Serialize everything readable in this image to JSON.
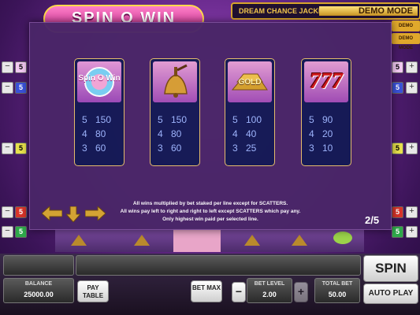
{
  "game": {
    "logo_text": "SPIN O WIN",
    "jackpot_label": "DREAM CHANCE JACKPOT",
    "demo_mode": "DEMO MODE",
    "demo_mode_small": "DEMO MODE"
  },
  "side_markers": {
    "left": [
      "5",
      "5",
      "5",
      "5",
      "5"
    ],
    "right": [
      "5",
      "5",
      "5",
      "5",
      "5"
    ],
    "left_colors": [
      "#f2c9f2",
      "#3a52d8",
      "#e7e04c",
      "#d8342a",
      "#2ea84a"
    ],
    "right_colors": [
      "#f2c9f2",
      "#3a52d8",
      "#e7e04c",
      "#d8342a",
      "#2ea84a"
    ]
  },
  "paytable": {
    "symbols": [
      {
        "icon": "spin-o-win-logo-icon",
        "logo_text": "Spin O Win",
        "pays": [
          {
            "count": "5",
            "value": "150"
          },
          {
            "count": "4",
            "value": "80"
          },
          {
            "count": "3",
            "value": "60"
          }
        ]
      },
      {
        "icon": "bell-icon",
        "pays": [
          {
            "count": "5",
            "value": "150"
          },
          {
            "count": "4",
            "value": "80"
          },
          {
            "count": "3",
            "value": "60"
          }
        ]
      },
      {
        "icon": "gold-bars-icon",
        "logo_text": "GOLD",
        "pays": [
          {
            "count": "5",
            "value": "100"
          },
          {
            "count": "4",
            "value": "40"
          },
          {
            "count": "3",
            "value": "25"
          }
        ]
      },
      {
        "icon": "triple-seven-icon",
        "logo_text": "777",
        "pays": [
          {
            "count": "5",
            "value": "90"
          },
          {
            "count": "4",
            "value": "20"
          },
          {
            "count": "3",
            "value": "10"
          }
        ]
      }
    ],
    "notes": [
      "All wins multiplied by bet staked per line except for SCATTERS.",
      "All wins pay left to right and right to left except SCATTERS which pay any.",
      "Only highest win paid per selected line."
    ],
    "page": "2/5"
  },
  "controls": {
    "balance_label": "BALANCE",
    "balance_value": "25000.00",
    "paytable_label": "PAY TABLE",
    "bet_max_label": "BET MAX",
    "bet_level_label": "BET LEVEL",
    "bet_level_value": "2.00",
    "total_bet_label": "TOTAL BET",
    "total_bet_value": "50.00",
    "spin_label": "SPIN",
    "autoplay_label": "AUTO PLAY",
    "minus": "−",
    "plus": "+"
  },
  "colors": {
    "accent_gold": "#e9c16a",
    "card_bg": "#141a55",
    "pay_text": "#9fb8ff"
  }
}
